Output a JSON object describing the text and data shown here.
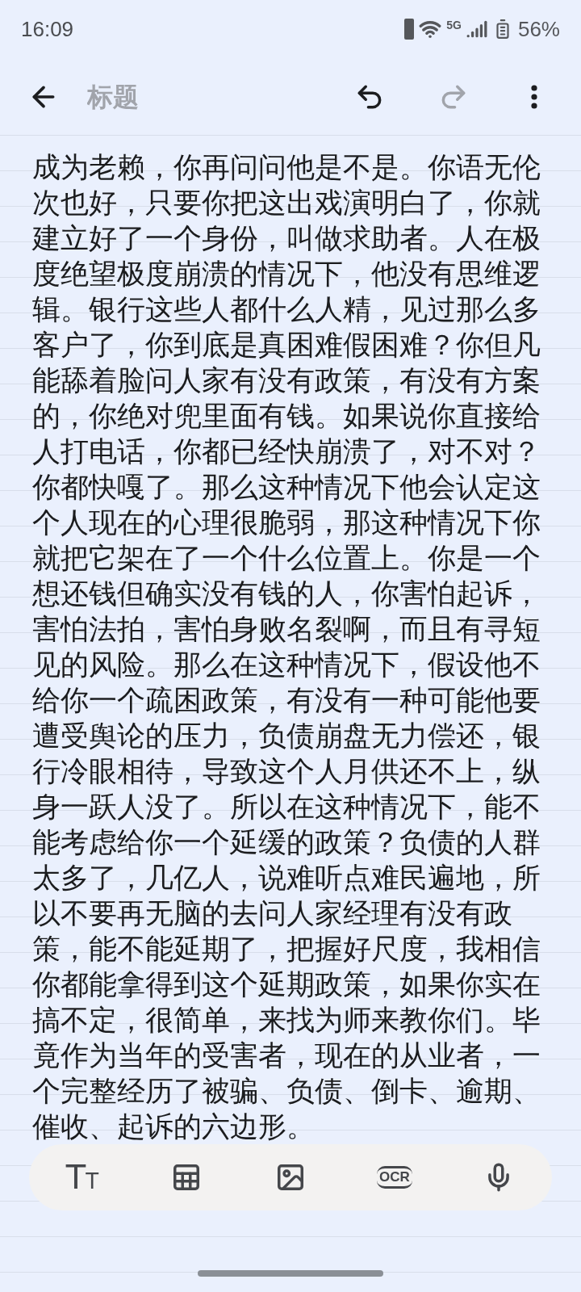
{
  "status_bar": {
    "time": "16:09",
    "network": "5G",
    "battery": "56%"
  },
  "header": {
    "title_placeholder": "标题",
    "undo": {
      "disabled": false
    },
    "redo": {
      "disabled": true
    }
  },
  "note": {
    "body": "成为老赖，你再问问他是不是。你语无伦次也好，只要你把这出戏演明白了，你就建立好了一个身份，叫做求助者。人在极度绝望极度崩溃的情况下，他没有思维逻辑。银行这些人都什么人精，见过那么多客户了，你到底是真困难假困难？你但凡能舔着脸问人家有没有政策，有没有方案的，你绝对兜里面有钱。如果说你直接给人打电话，你都已经快崩溃了，对不对？你都快嘎了。那么这种情况下他会认定这个人现在的心理很脆弱，那这种情况下你就把它架在了一个什么位置上。你是一个想还钱但确实没有钱的人，你害怕起诉，害怕法拍，害怕身败名裂啊，而且有寻短见的风险。那么在这种情况下，假设他不给你一个疏困政策，有没有一种可能他要遭受舆论的压力，负债崩盘无力偿还，银行冷眼相待，导致这个人月供还不上，纵身一跃人没了。所以在这种情况下，能不能考虑给你一个延缓的政策？负债的人群太多了，几亿人，说难听点难民遍地，所以不要再无脑的去问人家经理有没有政策，能不能延期了，把握好尺度，我相信你都能拿得到这个延期政策，如果你实在搞不定，很简单，来找为师来教你们。毕竟作为当年的受害者，现在的从业者，一个完整经历了被骗、负债、倒卡、逾期、催收、起诉的六边形。"
  },
  "toolbar": [
    {
      "kind": "text_format",
      "label": "TT"
    },
    {
      "kind": "table"
    },
    {
      "kind": "image"
    },
    {
      "kind": "ocr",
      "label": "OCR"
    },
    {
      "kind": "voice"
    }
  ]
}
